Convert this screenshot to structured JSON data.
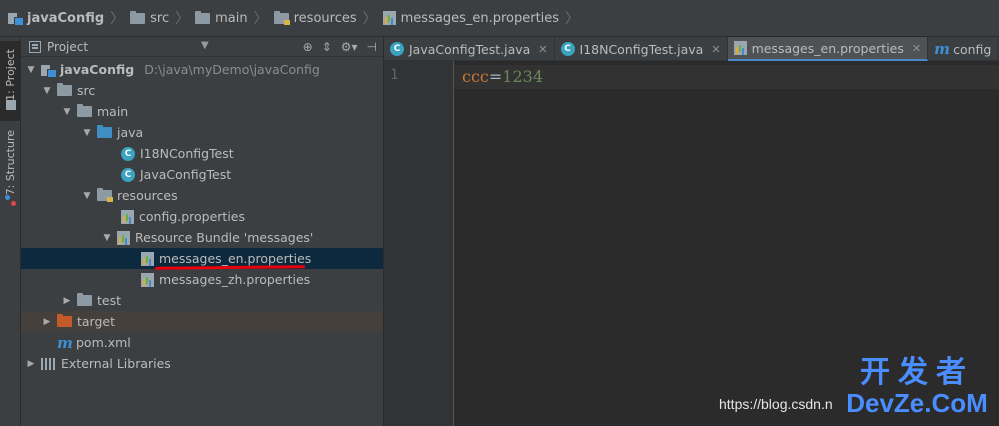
{
  "breadcrumb": [
    {
      "label": "javaConfig",
      "icon": "module-icon",
      "bold": true
    },
    {
      "label": "src",
      "icon": "folder-icon"
    },
    {
      "label": "main",
      "icon": "folder-icon"
    },
    {
      "label": "resources",
      "icon": "resources-folder-icon"
    },
    {
      "label": "messages_en.properties",
      "icon": "properties-file-icon"
    }
  ],
  "tool_stripe": {
    "project_tab": "1: Project",
    "structure_tab": "7: Structure"
  },
  "project_panel": {
    "title": "Project",
    "tree": [
      {
        "label": "javaConfig",
        "path": "D:\\java\\myDemo\\javaConfig",
        "depth": 0,
        "arrow": "down",
        "icon": "module"
      },
      {
        "label": "src",
        "depth": 1,
        "arrow": "down",
        "icon": "folder"
      },
      {
        "label": "main",
        "depth": 2,
        "arrow": "down",
        "icon": "folder"
      },
      {
        "label": "java",
        "depth": 3,
        "arrow": "down",
        "icon": "folder-blue"
      },
      {
        "label": "I18NConfigTest",
        "depth": 4,
        "arrow": "none",
        "icon": "class"
      },
      {
        "label": "JavaConfigTest",
        "depth": 4,
        "arrow": "none",
        "icon": "class"
      },
      {
        "label": "resources",
        "depth": 3,
        "arrow": "down",
        "icon": "folder-res"
      },
      {
        "label": "config.properties",
        "depth": 4,
        "arrow": "none",
        "icon": "props"
      },
      {
        "label": "Resource Bundle 'messages'",
        "depth": 4,
        "arrow": "down",
        "icon": "props"
      },
      {
        "label": "messages_en.properties",
        "depth": 5,
        "arrow": "none",
        "icon": "props",
        "selected": true
      },
      {
        "label": "messages_zh.properties",
        "depth": 5,
        "arrow": "none",
        "icon": "props"
      },
      {
        "label": "test",
        "depth": 2,
        "arrow": "right",
        "icon": "folder"
      },
      {
        "label": "target",
        "depth": 1,
        "arrow": "right",
        "icon": "folder-orange",
        "highlight": true
      },
      {
        "label": "pom.xml",
        "depth": 1,
        "arrow": "none",
        "icon": "maven"
      },
      {
        "label": "External Libraries",
        "depth": 0,
        "arrow": "right",
        "icon": "library"
      }
    ]
  },
  "editor_tabs": [
    {
      "label": "JavaConfigTest.java",
      "icon": "class",
      "closable": true
    },
    {
      "label": "I18NConfigTest.java",
      "icon": "class",
      "closable": true
    },
    {
      "label": "messages_en.properties",
      "icon": "props",
      "closable": true,
      "active": true
    },
    {
      "label": "config",
      "icon": "maven",
      "closable": false
    }
  ],
  "editor": {
    "line_number": "1",
    "key": "ccc",
    "equals": "=",
    "value": "1234"
  },
  "watermark": {
    "url": "https://blog.csdn.n",
    "brand_cn": "开发者",
    "brand_en": "DevZe.CoM"
  },
  "colors": {
    "selection": "#0d293e",
    "underline": "#e8000a",
    "key": "#cc7832",
    "value": "#6a8759",
    "brand": "#4a8dff"
  }
}
